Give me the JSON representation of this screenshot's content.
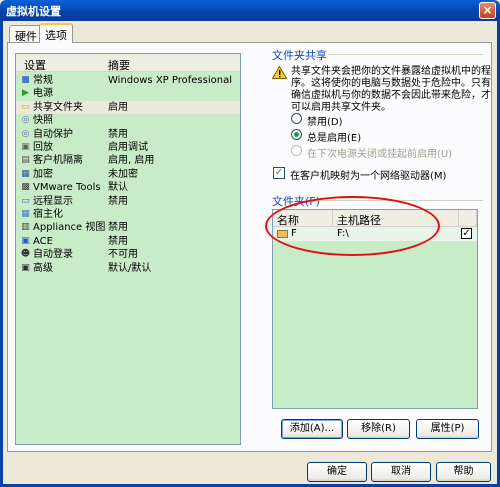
{
  "window": {
    "title": "虚拟机设置",
    "close": "×"
  },
  "tabs": [
    {
      "label": "硬件"
    },
    {
      "label": "选项"
    }
  ],
  "list": {
    "headers": {
      "setting": "设置",
      "summary": "摘要"
    },
    "rows": [
      {
        "name": "常规",
        "value": "Windows XP Professional",
        "icon": "general-icon",
        "glyph": "■",
        "color": "#4a7ac0"
      },
      {
        "name": "电源",
        "value": "",
        "icon": "power-icon",
        "glyph": "▶",
        "color": "#21a121"
      },
      {
        "name": "共享文件夹",
        "value": "启用",
        "icon": "folder-icon",
        "glyph": "▭",
        "color": "#d8a030"
      },
      {
        "name": "快照",
        "value": "",
        "icon": "snapshot-icon",
        "glyph": "◎",
        "color": "#6070a0"
      },
      {
        "name": "自动保护",
        "value": "禁用",
        "icon": "autoprotect-icon",
        "glyph": "◎",
        "color": "#6070a0"
      },
      {
        "name": "回放",
        "value": "启用调试",
        "icon": "replay-icon",
        "glyph": "▣",
        "color": "#606060"
      },
      {
        "name": "客户机隔离",
        "value": "启用, 启用",
        "icon": "isolation-icon",
        "glyph": "▤",
        "color": "#505050"
      },
      {
        "name": "加密",
        "value": "未加密",
        "icon": "encryption-icon",
        "glyph": "▦",
        "color": "#3050a0"
      },
      {
        "name": "VMware Tools",
        "value": "默认",
        "icon": "vmware-tools-icon",
        "glyph": "▩",
        "color": "#404040"
      },
      {
        "name": "远程显示",
        "value": "禁用",
        "icon": "remote-display-icon",
        "glyph": "▭",
        "color": "#3060b0"
      },
      {
        "name": "宿主化",
        "value": "",
        "icon": "unity-icon",
        "glyph": "▦",
        "color": "#4080c0"
      },
      {
        "name": "Appliance 视图",
        "value": "禁用",
        "icon": "appliance-view-icon",
        "glyph": "▥",
        "color": "#404040"
      },
      {
        "name": "ACE",
        "value": "禁用",
        "icon": "ace-icon",
        "glyph": "▣",
        "color": "#2060c0"
      },
      {
        "name": "自动登录",
        "value": "不可用",
        "icon": "autologon-icon",
        "glyph": "☻",
        "color": "#303030"
      },
      {
        "name": "高级",
        "value": "默认/默认",
        "icon": "advanced-icon",
        "glyph": "▣",
        "color": "#303030"
      }
    ],
    "selected_index": 2
  },
  "sharing": {
    "group_title": "文件夹共享",
    "warning": "共享文件夹会把你的文件暴露给虚拟机中的程序。这将使你的电脑与数据处于危险中。只有确信虚拟机与你的数据不会因此带来危险，才可以启用共享文件夹。",
    "options": [
      {
        "label": "禁用(D)",
        "checked": false,
        "disabled": false
      },
      {
        "label": "总是启用(E)",
        "checked": true,
        "disabled": false
      },
      {
        "label": "在下次电源关闭或挂起前启用(U)",
        "checked": false,
        "disabled": true
      }
    ],
    "map_drive_label": "在客户机映射为一个网络驱动器(M)",
    "map_drive_checked": true
  },
  "folders": {
    "group_title": "文件夹(F)",
    "headers": {
      "name": "名称",
      "path": "主机路径"
    },
    "rows": [
      {
        "name": "F",
        "path": "F:\\",
        "enabled": true
      }
    ],
    "buttons": {
      "add": "添加(A)...",
      "remove": "移除(R)",
      "properties": "属性(P)"
    }
  },
  "footer": {
    "ok": "确定",
    "cancel": "取消",
    "help": "帮助"
  }
}
